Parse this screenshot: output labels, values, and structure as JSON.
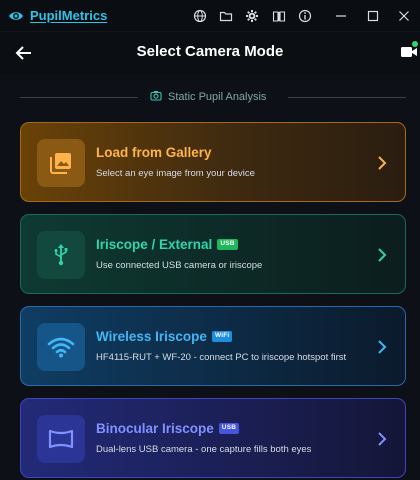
{
  "app": {
    "name": "PupilMetrics"
  },
  "titlebar": {
    "icons": [
      "globe-icon",
      "folder-icon",
      "gear-icon",
      "book-icon",
      "info-icon",
      "minimize-icon",
      "maximize-icon",
      "close-icon"
    ]
  },
  "header": {
    "title": "Select Camera Mode"
  },
  "section": {
    "label": "Static Pupil Analysis"
  },
  "cards": [
    {
      "title": "Load from Gallery",
      "badge": "",
      "subtitle": "Select an eye image from your device",
      "icon": "gallery-icon",
      "accent": "#ffb34a"
    },
    {
      "title": "Iriscope / External",
      "badge": "USB",
      "subtitle": "Use connected USB camera or iriscope",
      "icon": "usb-icon",
      "accent": "#2fd6ad"
    },
    {
      "title": "Wireless Iriscope",
      "badge": "WiFi",
      "subtitle": "HF4115-RUT + WF-20 - connect PC to iriscope hotspot first",
      "icon": "wifi-icon",
      "accent": "#43b6f5"
    },
    {
      "title": "Binocular Iriscope",
      "badge": "USB",
      "subtitle": "Dual-lens USB camera - one capture fills both eyes",
      "icon": "binocular-icon",
      "accent": "#7f92ff"
    }
  ],
  "colors": {
    "brand": "#2ec4e8",
    "background": "#0d1117",
    "status_dot": "#2fd86e"
  }
}
